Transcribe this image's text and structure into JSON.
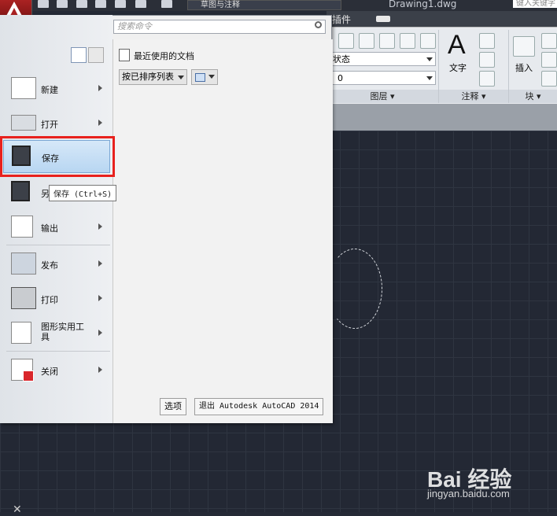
{
  "title_bar": {
    "workspace": "草图与注释",
    "document_title": "Drawing1.dwg",
    "search_placeholder": "键入关键字"
  },
  "ribbon": {
    "tab_plugin": "插件",
    "layer_state_label": "状态",
    "layer_value": "0",
    "panel_layer": "图层",
    "panel_annotation": "注释",
    "panel_block": "块",
    "text_button": "文字",
    "insert_button": "插入"
  },
  "app_menu": {
    "search_placeholder": "搜索命令",
    "recent_docs_title": "最近使用的文档",
    "sort_option": "按已排序列表",
    "items": [
      {
        "label": "新建"
      },
      {
        "label": "打开"
      },
      {
        "label": "保存"
      },
      {
        "label": "另"
      },
      {
        "label": "输出"
      },
      {
        "label": "发布"
      },
      {
        "label": "打印"
      },
      {
        "label": "图形实用工具"
      },
      {
        "label": "关闭"
      }
    ],
    "tooltip": "保存 (Ctrl+S)",
    "options_button": "选项",
    "exit_button": "退出 Autodesk AutoCAD 2014"
  },
  "watermark": {
    "brand": "Bai 经验",
    "url": "jingyan.baidu.com"
  },
  "colors": {
    "highlight_border": "#e8211d",
    "canvas_bg": "#232834",
    "logo_red": "#a22222"
  }
}
